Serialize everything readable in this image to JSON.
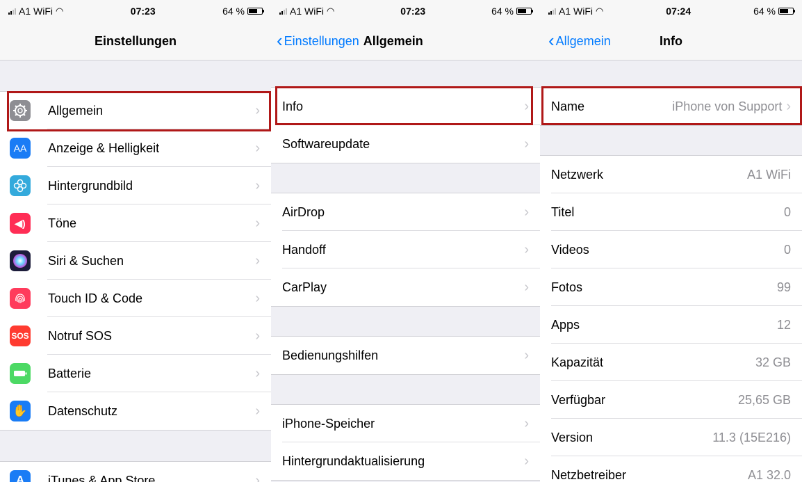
{
  "screens": [
    {
      "status": {
        "carrier": "A1 WiFi",
        "time": "07:23",
        "battery": "64 %"
      },
      "nav": {
        "title": "Einstellungen",
        "back": ""
      },
      "rows": [
        {
          "label": "Allgemein",
          "icon": "gear-icon",
          "color": "#8e8e93"
        },
        {
          "label": "Anzeige & Helligkeit",
          "icon": "display-icon",
          "color": "#1a7cf5"
        },
        {
          "label": "Hintergrundbild",
          "icon": "wallpaper-icon",
          "color": "#34aadc"
        },
        {
          "label": "Töne",
          "icon": "sound-icon",
          "color": "#ff2d55"
        },
        {
          "label": "Siri & Suchen",
          "icon": "siri-icon",
          "color": "#1c1c3a"
        },
        {
          "label": "Touch ID & Code",
          "icon": "fingerprint-icon",
          "color": "#ff3b5c"
        },
        {
          "label": "Notruf SOS",
          "icon": "sos-icon",
          "color": "#ff3b30",
          "icon_text": "SOS"
        },
        {
          "label": "Batterie",
          "icon": "battery-icon",
          "color": "#4cd964"
        },
        {
          "label": "Datenschutz",
          "icon": "hand-icon",
          "color": "#1a7cf5"
        },
        {
          "label": "iTunes & App Store",
          "icon": "appstore-icon",
          "color": "#1a7cf5"
        }
      ]
    },
    {
      "status": {
        "carrier": "A1 WiFi",
        "time": "07:23",
        "battery": "64 %"
      },
      "nav": {
        "title": "Allgemein",
        "back": "Einstellungen"
      },
      "rows": [
        {
          "label": "Info"
        },
        {
          "label": "Softwareupdate"
        },
        {
          "label": "AirDrop"
        },
        {
          "label": "Handoff"
        },
        {
          "label": "CarPlay"
        },
        {
          "label": "Bedienungshilfen"
        },
        {
          "label": "iPhone-Speicher"
        },
        {
          "label": "Hintergrundaktualisierung"
        }
      ]
    },
    {
      "status": {
        "carrier": "A1 WiFi",
        "time": "07:24",
        "battery": "64 %"
      },
      "nav": {
        "title": "Info",
        "back": "Allgemein"
      },
      "rows": [
        {
          "label": "Name",
          "value": "iPhone von Support"
        },
        {
          "label": "Netzwerk",
          "value": "A1 WiFi"
        },
        {
          "label": "Titel",
          "value": "0"
        },
        {
          "label": "Videos",
          "value": "0"
        },
        {
          "label": "Fotos",
          "value": "99"
        },
        {
          "label": "Apps",
          "value": "12"
        },
        {
          "label": "Kapazität",
          "value": "32 GB"
        },
        {
          "label": "Verfügbar",
          "value": "25,65 GB"
        },
        {
          "label": "Version",
          "value": "11.3 (15E216)"
        },
        {
          "label": "Netzbetreiber",
          "value": "A1 32.0"
        }
      ]
    }
  ],
  "colors": {
    "highlight": "#b01818",
    "link": "#007aff"
  }
}
